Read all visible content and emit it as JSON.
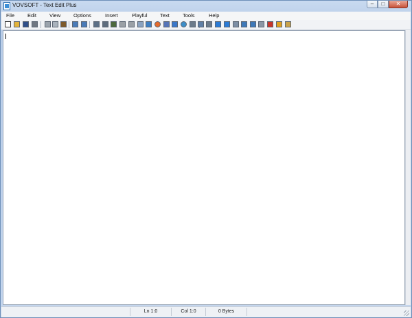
{
  "window": {
    "title": "VOVSOFT - Text Edit Plus"
  },
  "window_controls": {
    "minimize": "–",
    "maximize": "□",
    "close": "✕"
  },
  "menu": [
    "File",
    "Edit",
    "View",
    "Options",
    "Insert",
    "Playful",
    "Text",
    "Tools",
    "Help"
  ],
  "toolbar": {
    "icons": [
      {
        "name": "new-file-icon",
        "color": "#ffffff"
      },
      {
        "name": "open-folder-icon",
        "color": "#e2b33c"
      },
      {
        "name": "save-icon",
        "color": "#2f4f8a"
      },
      {
        "name": "print-icon",
        "color": "#6f7782"
      },
      {
        "name": "cut-icon",
        "color": "#9aa3ad"
      },
      {
        "name": "copy-icon",
        "color": "#aab3bd"
      },
      {
        "name": "paste-icon",
        "color": "#7d5a2c"
      },
      {
        "name": "find-icon",
        "color": "#4a7bb8"
      },
      {
        "name": "replace-icon",
        "color": "#4a7bb8"
      },
      {
        "name": "document-icon",
        "color": "#5b6f86"
      },
      {
        "name": "monitor-icon",
        "color": "#5d6c7d"
      },
      {
        "name": "font-icon",
        "color": "#4d6a3e"
      },
      {
        "name": "lock-icon",
        "color": "#9aa0a6"
      },
      {
        "name": "unlock-icon",
        "color": "#9aa0a6"
      },
      {
        "name": "page-icon",
        "color": "#8aa2c0"
      },
      {
        "name": "translate-icon",
        "color": "#3f7fc2"
      },
      {
        "name": "color-wheel-icon",
        "color": "#e56b2d"
      },
      {
        "name": "brush-icon",
        "color": "#5574b8"
      },
      {
        "name": "filter-icon",
        "color": "#3a77c9"
      },
      {
        "name": "web-icon",
        "color": "#3d8ec9"
      },
      {
        "name": "list-icon",
        "color": "#6c7b8b"
      },
      {
        "name": "email-icon",
        "color": "#5f7fa6"
      },
      {
        "name": "sort-icon",
        "color": "#6c7b8b"
      },
      {
        "name": "arrow-right-icon",
        "color": "#2b7bd6"
      },
      {
        "name": "arrow-down-icon",
        "color": "#2b7bd6"
      },
      {
        "name": "doc-copy-icon",
        "color": "#7c8ea5"
      },
      {
        "name": "move-up-icon",
        "color": "#3e78b8"
      },
      {
        "name": "move-down-icon",
        "color": "#3e78b8"
      },
      {
        "name": "text-file-icon",
        "color": "#8a96a5"
      },
      {
        "name": "calendar-icon",
        "color": "#c8342a"
      },
      {
        "name": "warning-icon",
        "color": "#e0a020"
      },
      {
        "name": "note-icon",
        "color": "#c9a24a"
      }
    ]
  },
  "editor": {
    "content": ""
  },
  "status": {
    "line": "Ln 1:0",
    "column": "Col 1:0",
    "size": "0 Bytes"
  }
}
